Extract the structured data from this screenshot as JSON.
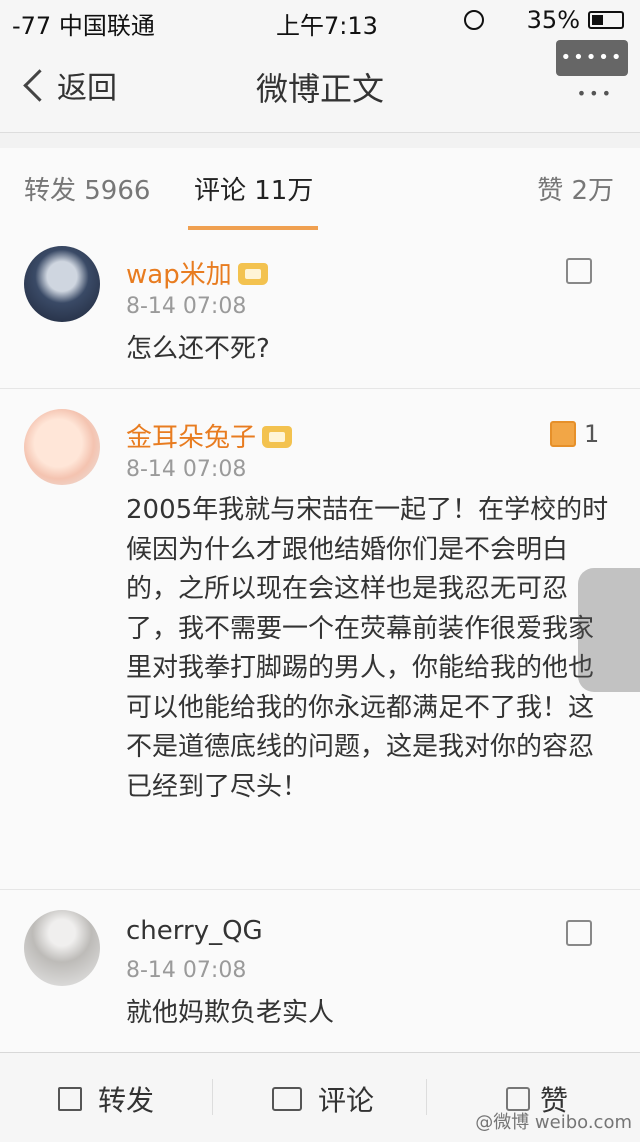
{
  "status_bar": {
    "signal": "-77 中国联通",
    "time": "上午7:13",
    "battery": "35%"
  },
  "nav": {
    "back_label": "返回",
    "title": "微博正文",
    "more_label": "•••••"
  },
  "tabs": {
    "reposts": "转发 5966",
    "comments": "评论 11万",
    "likes": "赞 2万"
  },
  "comments": [
    {
      "username": "wap米加",
      "time": "8-14 07:08",
      "text": "怎么还不死?",
      "likes": ""
    },
    {
      "username": "金耳朵兔子",
      "time": "8-14 07:08",
      "text": "2005年我就与宋喆在一起了！在学校的时候因为什么才跟他结婚你们是不会明白的，之所以现在会这样也是我忍无可忍了，我不需要一个在荧幕前装作很爱我家里对我拳打脚踢的男人，你能给我的他也可以他能给我的你永远都满足不了我！这不是道德底线的问题，这是我对你的容忍已经到了尽头！",
      "likes": "1"
    },
    {
      "username": "cherry_QG",
      "time": "8-14 07:08",
      "text": "就他妈欺负老实人",
      "likes": ""
    }
  ],
  "bottom_bar": {
    "repost": "转发",
    "comment": "评论",
    "like": "赞"
  },
  "watermark": "@微博 weibo.com"
}
